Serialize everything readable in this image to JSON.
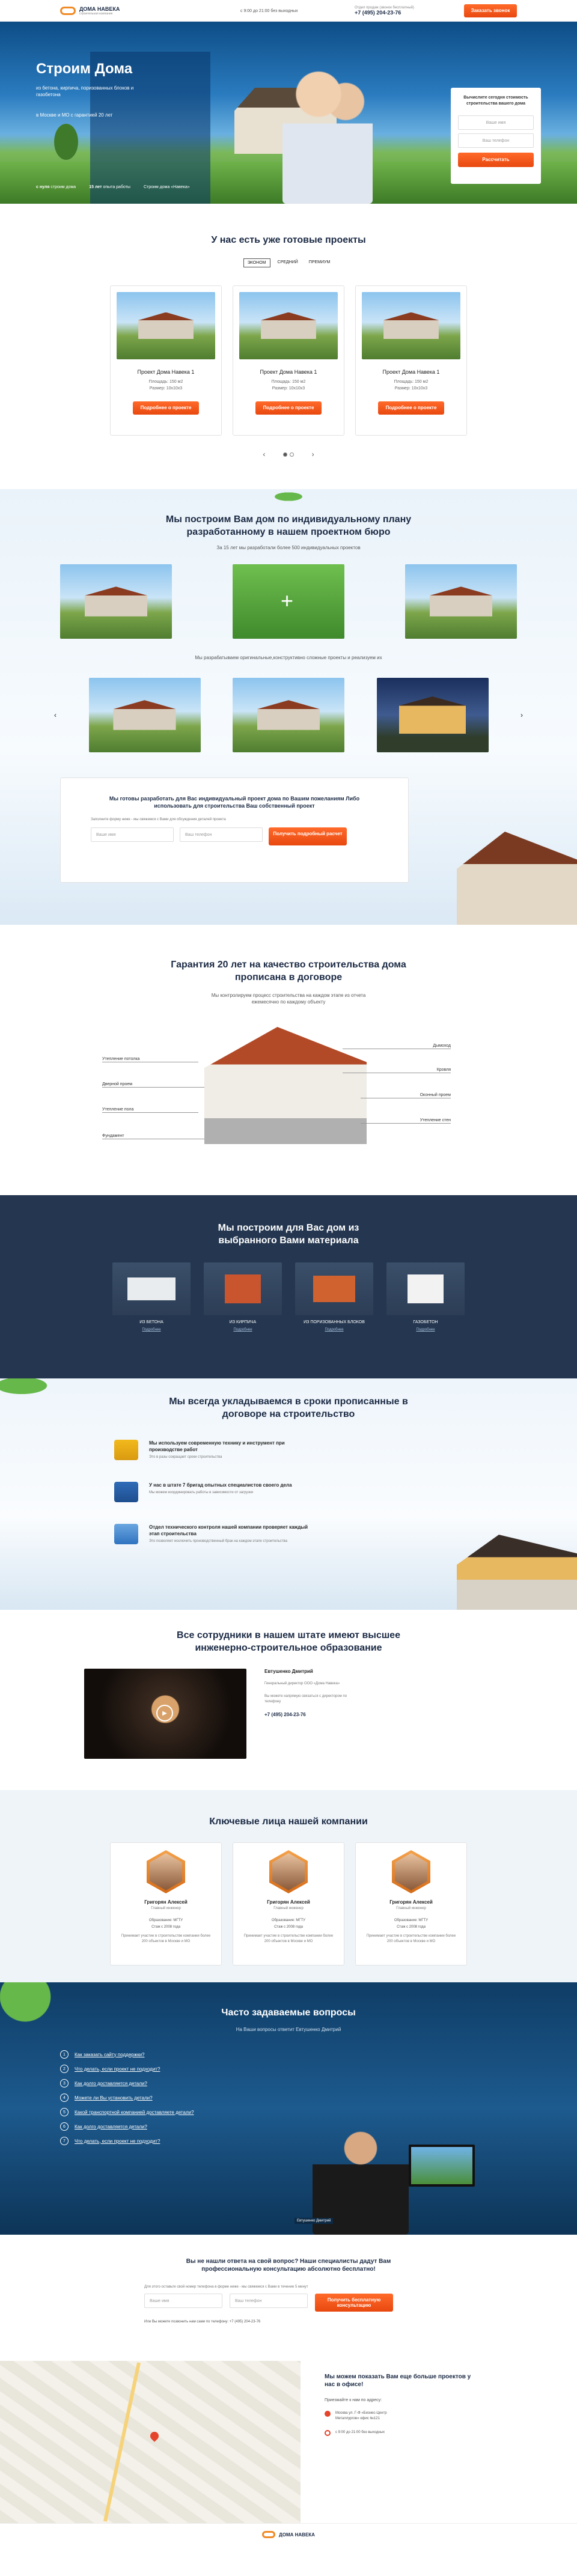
{
  "header": {
    "logo": "ДОМА НАВЕКА",
    "logo_caption": "строительная компания",
    "hours": "с 9:00 до 21:00 без выходных",
    "phone_caption": "Отдел продаж (звонок бесплатный)",
    "phone": "+7 (495) 204-23-76",
    "callback_button": "Заказать звонок"
  },
  "hero": {
    "title": "Строим Дома",
    "subtitle": "из бетона, кирпича, поризованных блоков и газобетона",
    "region": "в Москве и МО с гарантией 20 лет",
    "stat1_value": "с нуля",
    "stat1_label": "строим дома",
    "stat2_value": "15 лет",
    "stat2_label": "опыта работы",
    "stat3_label": "Строим дома «Навека»",
    "form_title": "Вычислите сегодня стоимость строительства вашего дома",
    "form_name_placeholder": "Ваше имя",
    "form_phone_placeholder": "Ваш телефон",
    "form_button": "Рассчитать"
  },
  "projects": {
    "title": "У нас есть уже готовые проекты",
    "tabs": [
      "ЭКОНОМ",
      "СРЕДНИЙ",
      "ПРЕМИУМ"
    ],
    "items": [
      {
        "name": "Проект Дома Навека 1",
        "area": "Площадь: 150 м2",
        "size": "Размер: 10х10х3",
        "button": "Подробнее о проекте"
      },
      {
        "name": "Проект Дома Навека 1",
        "area": "Площадь: 150 м2",
        "size": "Размер: 10х10х3",
        "button": "Подробнее о проекте"
      },
      {
        "name": "Проект Дома Навека 1",
        "area": "Площадь: 150 м2",
        "size": "Размер: 10х10х3",
        "button": "Подробнее о проекте"
      }
    ]
  },
  "individual": {
    "title": "Мы построим Вам дом по индивидуальному плану разработанному в нашем проектном бюро",
    "subtitle": "За 15 лет мы разработали более 500 индивидуальных проектов",
    "mid_text": "Мы разрабатываем оригинальные,конструктивно сложные проекты и реализуем их",
    "form_title": "Мы готовы разработать для Вас индивидуальный проект дома по Вашим пожеланиям Либо использовать для строительства Ваш собственный проект",
    "form_note": "Заполните форму ниже - мы свяжемся с Вами для обсуждения деталей проекта",
    "name_placeholder": "Ваше имя",
    "phone_placeholder": "Ваш телефон",
    "button": "Получить подробный расчет"
  },
  "guarantee": {
    "title": "Гарантия 20 лет на качество строительства дома прописана в договоре",
    "subtitle": "Мы контролируем процесс строительства на каждом этапе из отчета ежемесячно по каждому объекту",
    "labels_left": [
      "Утепление потолка",
      "Дверной проем",
      "Утепление пола",
      "Фундамент"
    ],
    "labels_right": [
      "Дымоход",
      "Кровля",
      "Оконный проем",
      "Утепление стен"
    ]
  },
  "materials": {
    "title": "Мы построим для Вас дом из выбранного Вами материала",
    "items": [
      {
        "name": "ИЗ БЕТОНА",
        "link": "Подробнее"
      },
      {
        "name": "ИЗ КИРПИЧА",
        "link": "Подробнее"
      },
      {
        "name": "ИЗ ПОРИЗОВАННЫХ БЛОКОВ",
        "link": "Подробнее"
      },
      {
        "name": "ГАЗОБЕТОН",
        "link": "Подробнее"
      }
    ]
  },
  "deadlines": {
    "title": "Мы всегда укладываемся в сроки прописанные в договоре на строительство",
    "items": [
      {
        "title": "Мы используем современную технику и инструмент при производстве работ",
        "text": "Это в разы сокращает сроки строительства"
      },
      {
        "title": "У нас в штате 7 бригад опытных специалистов своего дела",
        "text": "Мы можем координировать работы в зависимости от загрузки"
      },
      {
        "title": "Отдел технического контроля нашей компании проверяет каждый этап строительства",
        "text": "Это позволяет исключить производственный брак на каждом этапе строительства"
      }
    ]
  },
  "staff": {
    "title": "Все сотрудники в нашем штате имеют высшее инженерно-строительное образование",
    "person_name": "Евтушенко Дмитрий",
    "person_role": "Генеральный директор ООО «Дома Навека»",
    "person_quote": "Вы можете напрямую связаться с директором по телефону",
    "person_phone": "+7 (495) 204-23-76"
  },
  "team": {
    "title": "Ключевые лица нашей компании",
    "members": [
      {
        "name": "Григорян Алексей",
        "role": "Главный инженер",
        "edu": "Образование: МГТУ",
        "exp": "Стаж с 2008 года",
        "text": "Принимает участие в строительстве компании более 200 объектов в Москве и МО"
      },
      {
        "name": "Григорян Алексей",
        "role": "Главный инженер",
        "edu": "Образование: МГТУ",
        "exp": "Стаж с 2008 года",
        "text": "Принимает участие в строительстве компании более 200 объектов в Москве и МО"
      },
      {
        "name": "Григорян Алексей",
        "role": "Главный инженер",
        "edu": "Образование: МГТУ",
        "exp": "Стаж с 2008 года",
        "text": "Принимает участие в строительстве компании более 200 объектов в Москве и МО"
      }
    ]
  },
  "faq": {
    "title": "Часто задаваемые вопросы",
    "subtitle": "На Ваши вопросы ответит Евтушенко Дмитрий",
    "items": [
      "Как заказать сайту поддержки?",
      "Что делать, если проект не подходит?",
      "Как долго доставляется детали?",
      "Можете ли Вы установить детали?",
      "Какой транспортной компанией доставляете детали?",
      "Как долго доставляется детали?",
      "Что делать, если проект не подходит?"
    ],
    "person_caption": "Евтушенко Дмитрий"
  },
  "contact": {
    "title": "Вы не нашли ответа на свой вопрос? Наши специалисты дадут Вам профессиональную консультацию абсолютно бесплатно!",
    "note": "Для этого оставьте свой номер телефона в форме ниже - мы свяжемся с Вами в течение 5 минут",
    "name_placeholder": "Ваше имя",
    "phone_placeholder": "Ваш телефон",
    "button": "Получить бесплатную консультацию",
    "phone_line": "Или Вы можете позвонить нам сами по телефону: +7 (495) 204-23-76"
  },
  "map": {
    "title": "Мы можем показать Вам еще больше проектов у нас в офисе!",
    "invite": "Приезжайте к нам по адресу:",
    "address": "Москва ул. Г-Ф «Бизнес-Центр Металлургов» офис №121",
    "hours": "с 9:00 до 21:00 без выходных"
  },
  "footer": {
    "logo": "ДОМА НАВЕКА"
  }
}
